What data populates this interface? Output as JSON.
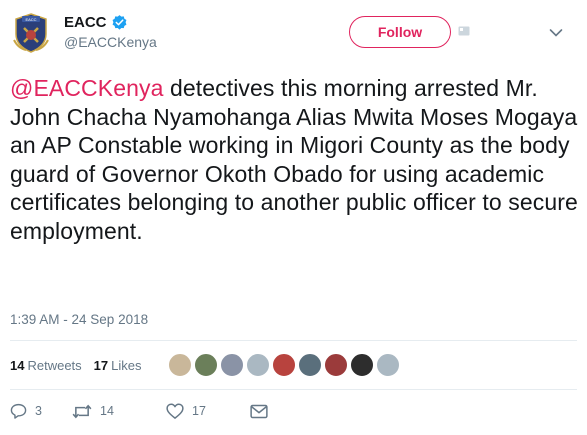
{
  "user": {
    "display_name": "EACC",
    "handle": "@EACCKenya",
    "avatar_label": "EACC"
  },
  "header": {
    "follow_label": "Follow"
  },
  "tweet": {
    "mention": "@EACCKenya",
    "body": " detectives this morning arrested Mr. John Chacha Nyamohanga Alias Mwita Moses Mogaya an AP Constable working in Migori County as the body guard of Governor Okoth Obado for using academic certificates belonging to another public officer to secure employment.",
    "timestamp": "1:39 AM - 24 Sep 2018"
  },
  "stats": {
    "retweets_count": "14",
    "retweets_label": "Retweets",
    "likes_count": "17",
    "likes_label": "Likes"
  },
  "actions": {
    "reply_count": "3",
    "retweet_count": "14",
    "like_count": "17"
  },
  "colors": {
    "accent": "#e0245e",
    "muted": "#657786",
    "text": "#14171a",
    "verified": "#1da1f2"
  },
  "likers": [
    {
      "name": "liker-1",
      "color": "#c9b79a"
    },
    {
      "name": "liker-2",
      "color": "#6b7f5a"
    },
    {
      "name": "liker-3",
      "color": "#8a93a6"
    },
    {
      "name": "liker-4",
      "color": "#aab8c2"
    },
    {
      "name": "liker-5",
      "color": "#b8433e"
    },
    {
      "name": "liker-6",
      "color": "#5a6f7c"
    },
    {
      "name": "liker-7",
      "color": "#9b3b3b"
    },
    {
      "name": "liker-8",
      "color": "#2d2d2d"
    },
    {
      "name": "liker-9",
      "color": "#aab8c2"
    }
  ]
}
